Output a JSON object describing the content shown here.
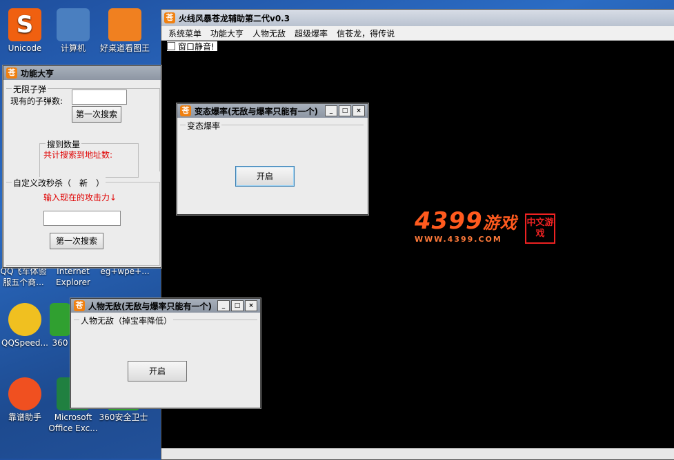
{
  "desktop": {
    "icons": [
      {
        "label": "Unicode",
        "color": "#f06010"
      },
      {
        "label": "计算机",
        "color": "#4a7fc0"
      },
      {
        "label": "好桌道看图王",
        "color": "#f08020"
      },
      {
        "label": "QQ飞车体验服五个商...",
        "color": "#3aa0e0"
      },
      {
        "label": "Internet Explorer",
        "color": "#3a7ad0"
      },
      {
        "label": "eg+wpe+...",
        "color": "#888888"
      },
      {
        "label": "QQSpeed...",
        "color": "#f0c020"
      },
      {
        "label": "360",
        "color": "#30a030"
      },
      {
        "label": "靠谱助手",
        "color": "#f05020"
      },
      {
        "label": "Microsoft Office Exc...",
        "color": "#208040"
      },
      {
        "label": "360安全卫士",
        "color": "#30a030"
      }
    ]
  },
  "main_window": {
    "title": "火线风暴苍龙辅助第二代v0.3",
    "icon_char": "苍",
    "menu": [
      "系统菜单",
      "功能大亨",
      "人物无敌",
      "超级爆率",
      "信苍龙，得传说"
    ],
    "mute_label": "窗口静音!"
  },
  "logo": {
    "main": "4399",
    "suffix": "游戏",
    "sub": "WWW.4399.COM",
    "seal": "中文游戏"
  },
  "feature_window": {
    "title": "功能大亨",
    "ammo_group": "无限子弹",
    "ammo_label": "现有的子弹数:",
    "ammo_value": "",
    "first_search": "第一次搜索",
    "found_group": "搜到数量",
    "found_label": "共计搜索到地址数:",
    "custom_group": "自定义改秒杀（　新　）",
    "attack_prompt": "输入现在的攻击力↓",
    "attack_value": "",
    "first_search2": "第一次搜索"
  },
  "drop_dialog": {
    "title": "变态爆率(无敌与爆率只能有一个)",
    "group": "变态爆率",
    "button": "开启"
  },
  "invincible_dialog": {
    "title": "人物无敌(无敌与爆率只能有一个)",
    "group": "人物无敌（掉宝率降低）",
    "button": "开启"
  },
  "window_buttons": {
    "min": "_",
    "max": "□",
    "close": "×"
  }
}
